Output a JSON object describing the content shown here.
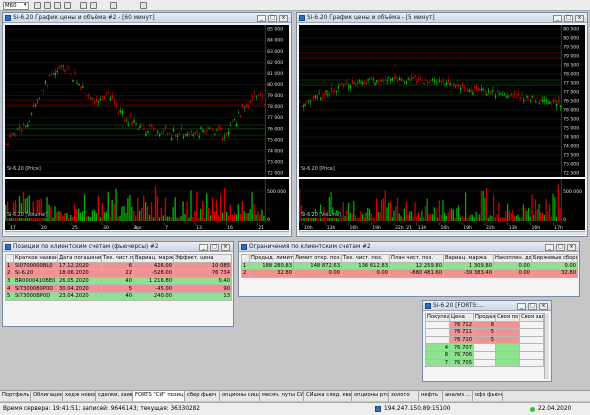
{
  "toolbar": {
    "timeframe": "M60",
    "icons": [
      "cursor-icon",
      "crosshair-icon",
      "zoom-in-icon",
      "zoom-out-icon",
      "line-tool-icon",
      "text-tool-icon",
      "arrow-icon",
      "settings-icon"
    ]
  },
  "chart1": {
    "title": "Si-6.20 График цены и объёма #2 - [60 минут]",
    "price_tag": "Si-6.20 [Price]",
    "volume_tag": "Si-6.20 [Volume]",
    "price_ticks": [
      "85 000",
      "84 000",
      "83 000",
      "82 000",
      "81 000",
      "80 000",
      "79 000",
      "78 000",
      "77 000",
      "76 000",
      "75 000",
      "74 000",
      "73 000",
      "72 000"
    ],
    "volume_ticks": [
      "500 000",
      "0"
    ],
    "dates": [
      "17",
      "20",
      "25",
      "30",
      "2",
      "7",
      "13",
      "16",
      "21"
    ],
    "month": "Apr"
  },
  "chart2": {
    "title": "Si-6.20 График цены и объёма - [5 минут]",
    "price_tag": "Si-6.20 [Price]",
    "volume_tag": "Si-6.20 [Volume]",
    "price_ticks": [
      "80 500",
      "80 000",
      "79 500",
      "79 000",
      "78 500",
      "78 000",
      "77 500",
      "77 000",
      "76 500",
      "76 000",
      "75 500",
      "75 000",
      "74 500",
      "74 000",
      "73 500",
      "73 000",
      "72 500"
    ],
    "volume_ticks": [
      "500 000",
      "0"
    ],
    "times": [
      "10h",
      "13h",
      "16h",
      "19h",
      "22h",
      "13h",
      "16h",
      "19h",
      "22h",
      "13h",
      "16h",
      "17h"
    ],
    "day": "21"
  },
  "positions": {
    "title": "Позиции по клиентским счетам (фьючерсы) #2",
    "headers": [
      "",
      "Краткое название",
      "Дата погашения",
      "Тек. чист.поз.",
      "Вариац. маржа",
      "Эффект. цена"
    ],
    "rows": [
      {
        "n": "1",
        "name": "Si0700000BL0",
        "date": "17.12.2020",
        "pos": "6",
        "var": "426.00",
        "eff": "10 085"
      },
      {
        "n": "2",
        "name": "Si-6.20",
        "date": "18.06.2020",
        "pos": "22",
        "var": "-528.00",
        "eff": "76 734"
      },
      {
        "n": "3",
        "name": "BR0000410BE0",
        "date": "26.05.2020",
        "pos": "40",
        "var": "1 216.80",
        "eff": "0.40"
      },
      {
        "n": "4",
        "name": "Si7300080P0D",
        "date": "30.04.2020",
        "pos": "5",
        "var": "-45.00",
        "eff": "90"
      },
      {
        "n": "5",
        "name": "Si73000BP0D",
        "date": "23.04.2020",
        "pos": "40",
        "var": "240.00",
        "eff": "13"
      }
    ]
  },
  "limits": {
    "title": "Ограничения по клиентским счетам #2",
    "headers": [
      "",
      "Предыд. лимит",
      "Лимит откр. поз.",
      "Тек. чист. поз.",
      "План чист. поз.",
      "Вариац. маржа",
      "Накоплен. доход",
      "Биржевые сборы"
    ],
    "rows": [
      {
        "n": "1",
        "prev": "188 280.83",
        "open": "148 872.63",
        "cur": "136 612.83",
        "plan": "12 259.80",
        "var": "1 309.80",
        "acc": "0.00",
        "fee": "0.00"
      },
      {
        "n": "2",
        "prev": "32.80",
        "open": "0.00",
        "cur": "0.00",
        "plan": "-880 481.60",
        "var": "-39 383.40",
        "acc": "0.00",
        "fee": "32.80"
      }
    ]
  },
  "depth": {
    "title": "Si-6.20 [FORTS:...",
    "headers": [
      "Покупка",
      "Цена",
      "Продажа",
      "Своя по",
      "Своя зая"
    ],
    "rows": [
      {
        "buy": "",
        "price": "76 712",
        "sell": "8",
        "side": "ask"
      },
      {
        "buy": "",
        "price": "76 711",
        "sell": "5",
        "side": "ask"
      },
      {
        "buy": "",
        "price": "76 710",
        "sell": "5",
        "side": "ask"
      },
      {
        "buy": "4",
        "price": "76 707",
        "sell": "",
        "side": "bid"
      },
      {
        "buy": "8",
        "price": "76 706",
        "sell": "",
        "side": "bid"
      },
      {
        "buy": "7",
        "price": "76 705",
        "sell": "",
        "side": "bid"
      }
    ]
  },
  "tabs": [
    "Портфель",
    "Облигации",
    "хедж новости",
    "сделки, заявки",
    "FORTS \"СИ\" позиции..",
    "сбер фьюч",
    "опционы сишка",
    "месяч. путы СИшка",
    "СИшка след. квартал",
    "опционы ртс",
    "золото",
    "нефть",
    "анализ ...",
    "офз фьючи"
  ],
  "active_tab": 4,
  "status": {
    "server": "Время сервера: 19:41:51; записей: 9646143; текущая: 36330282",
    "ip": "194.247.150.89:15100",
    "date": "22.04.2020"
  },
  "colors": {
    "up": "#00d000",
    "down": "#e00000",
    "volume_up": "#00b000",
    "volume_down": "#d40000",
    "win_title": "#d9e1ec"
  }
}
